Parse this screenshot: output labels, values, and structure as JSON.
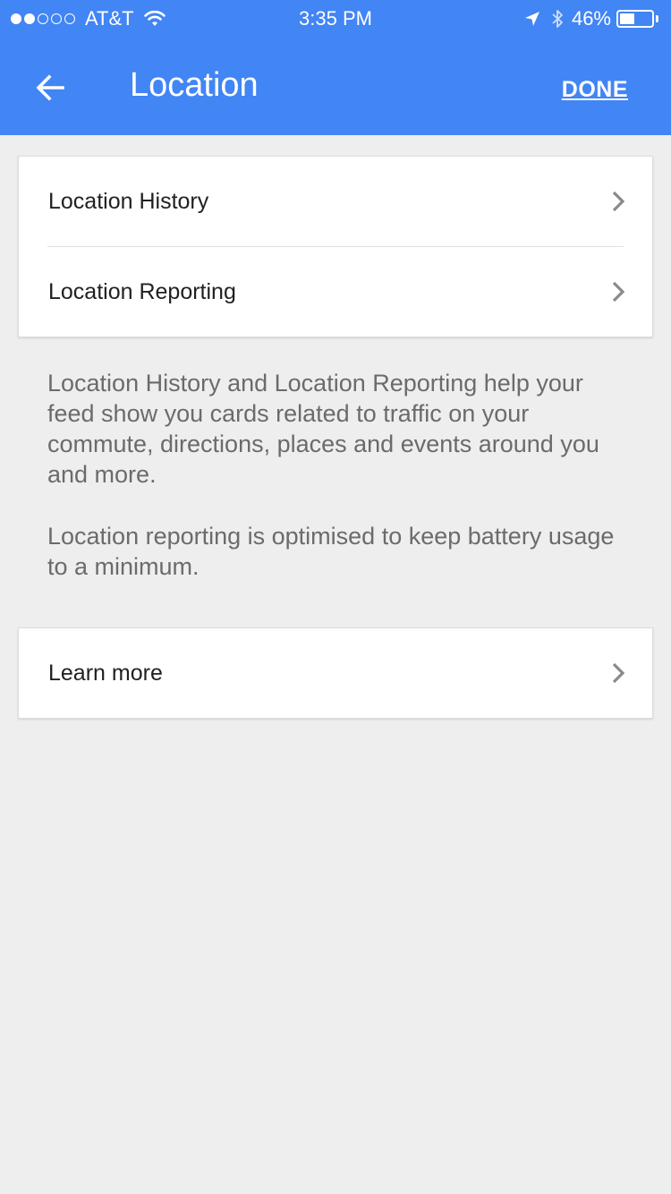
{
  "status_bar": {
    "carrier": "AT&T",
    "time": "3:35 PM",
    "battery_percent_label": "46%",
    "battery_level": 0.46,
    "signal_bars": 2
  },
  "header": {
    "title": "Location",
    "done_label": "DONE"
  },
  "settings": {
    "items": [
      {
        "label": "Location History"
      },
      {
        "label": "Location Reporting"
      }
    ]
  },
  "description": {
    "paragraph1": "Location History and Location Reporting help your feed show you cards related to traffic on your commute, directions, places and events around you and more.",
    "paragraph2": "Location reporting is optimised to keep battery usage to a minimum."
  },
  "learn_more": {
    "label": "Learn more"
  },
  "colors": {
    "app_bar": "#4285f4",
    "background": "#eeeeee",
    "chevron": "#8a8a8a"
  }
}
